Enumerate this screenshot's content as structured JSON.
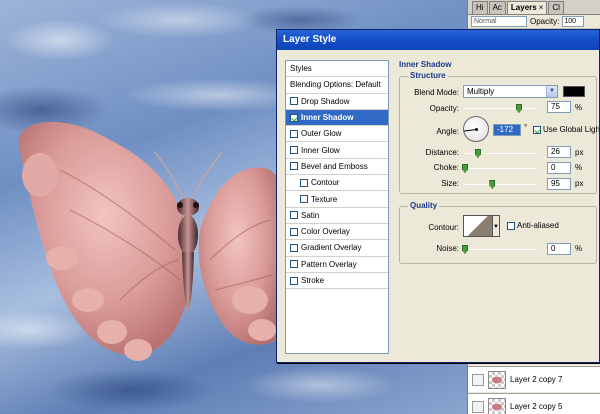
{
  "dialog": {
    "title": "Layer Style"
  },
  "styles_list": {
    "items": [
      {
        "label": "Styles",
        "checkbox": false,
        "checked": false,
        "selected": false,
        "indent": false
      },
      {
        "label": "Blending Options: Default",
        "checkbox": false,
        "checked": false,
        "selected": false,
        "indent": false
      },
      {
        "label": "Drop Shadow",
        "checkbox": true,
        "checked": false,
        "selected": false,
        "indent": false
      },
      {
        "label": "Inner Shadow",
        "checkbox": true,
        "checked": true,
        "selected": true,
        "indent": false
      },
      {
        "label": "Outer Glow",
        "checkbox": true,
        "checked": false,
        "selected": false,
        "indent": false
      },
      {
        "label": "Inner Glow",
        "checkbox": true,
        "checked": false,
        "selected": false,
        "indent": false
      },
      {
        "label": "Bevel and Emboss",
        "checkbox": true,
        "checked": false,
        "selected": false,
        "indent": false
      },
      {
        "label": "Contour",
        "checkbox": true,
        "checked": false,
        "selected": false,
        "indent": true
      },
      {
        "label": "Texture",
        "checkbox": true,
        "checked": false,
        "selected": false,
        "indent": true
      },
      {
        "label": "Satin",
        "checkbox": true,
        "checked": false,
        "selected": false,
        "indent": false
      },
      {
        "label": "Color Overlay",
        "checkbox": true,
        "checked": false,
        "selected": false,
        "indent": false
      },
      {
        "label": "Gradient Overlay",
        "checkbox": true,
        "checked": false,
        "selected": false,
        "indent": false
      },
      {
        "label": "Pattern Overlay",
        "checkbox": true,
        "checked": false,
        "selected": false,
        "indent": false
      },
      {
        "label": "Stroke",
        "checkbox": true,
        "checked": false,
        "selected": false,
        "indent": false
      }
    ]
  },
  "inner_shadow": {
    "section_title": "Inner Shadow",
    "structure": {
      "title": "Structure",
      "blend_mode_label": "Blend Mode:",
      "blend_mode_value": "Multiply",
      "color": "#000000",
      "opacity_label": "Opacity:",
      "opacity_value": "75",
      "opacity_unit": "%",
      "opacity_level": 0.75,
      "angle_label": "Angle:",
      "angle_value": "-172",
      "angle_unit": "°",
      "use_global_light_label": "Use Global Light",
      "use_global_light_checked": true,
      "distance_label": "Distance:",
      "distance_value": "26",
      "distance_unit": "px",
      "distance_level": 0.18,
      "choke_label": "Choke:",
      "choke_value": "0",
      "choke_unit": "%",
      "choke_level": 0,
      "size_label": "Size:",
      "size_value": "95",
      "size_unit": "px",
      "size_level": 0.38
    },
    "quality": {
      "title": "Quality",
      "contour_label": "Contour:",
      "anti_aliased_label": "Anti-aliased",
      "anti_aliased_checked": false,
      "noise_label": "Noise:",
      "noise_value": "0",
      "noise_unit": "%",
      "noise_level": 0
    }
  },
  "layers_panel": {
    "tabs": [
      {
        "label": "Hi",
        "active": false,
        "close": ""
      },
      {
        "label": "Ac",
        "active": false,
        "close": ""
      },
      {
        "label": "Layers",
        "active": true,
        "close": "×"
      },
      {
        "label": "Cl",
        "active": false,
        "close": ""
      }
    ],
    "blend_value": "Normal",
    "opacity_label": "Opacity:",
    "opacity_value": "100",
    "layers": [
      {
        "name": "Layer 2 copy 7"
      },
      {
        "name": "Layer 2 copy 5"
      }
    ]
  }
}
